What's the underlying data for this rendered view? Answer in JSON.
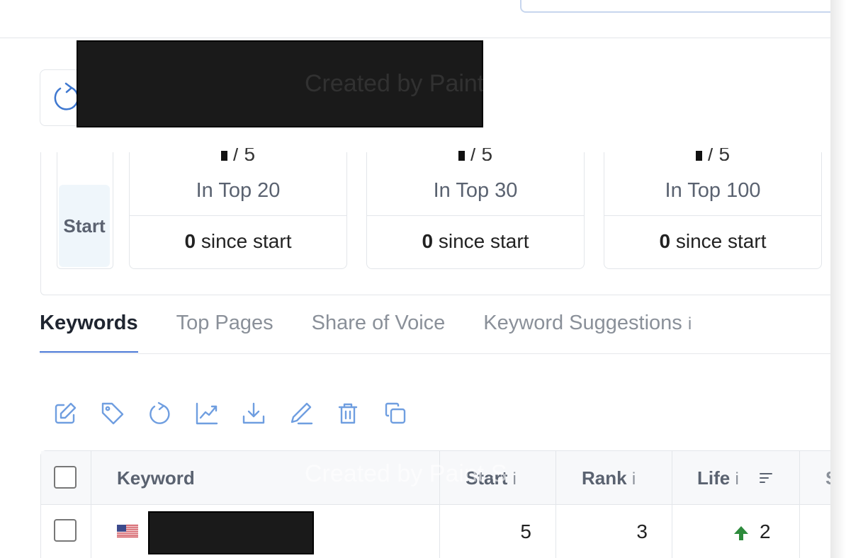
{
  "stats": {
    "start_label": "Start",
    "cards": [
      {
        "fraction_suffix": "/ 5",
        "label": "In Top 20",
        "since_value": "0",
        "since_text": "since start"
      },
      {
        "fraction_suffix": "/ 5",
        "label": "In Top 30",
        "since_value": "0",
        "since_text": "since start"
      },
      {
        "fraction_suffix": "/ 5",
        "label": "In Top 100",
        "since_value": "0",
        "since_text": "since start"
      }
    ]
  },
  "tabs": [
    {
      "label": "Keywords",
      "active": true
    },
    {
      "label": "Top Pages",
      "active": false
    },
    {
      "label": "Share of Voice",
      "active": false
    },
    {
      "label": "Keyword Suggestions",
      "info": "i",
      "active": false
    }
  ],
  "toolbar": {
    "icons": [
      "edit-icon",
      "tag-icon",
      "refresh-icon",
      "chart-icon",
      "download-icon",
      "pen-icon",
      "trash-icon",
      "copy-icon"
    ],
    "color": "#6f9ee0"
  },
  "table": {
    "headers": {
      "keyword": "Keyword",
      "start": "Start",
      "rank": "Rank",
      "life": "Life",
      "info": "i",
      "next_partial": "S"
    },
    "rows": [
      {
        "start": "5",
        "rank": "3",
        "life": "2",
        "life_trend": "up"
      }
    ]
  },
  "watermark": "Created by Paint S",
  "colors": {
    "accent": "#4a78d6",
    "up": "#2e8b3c",
    "icon": "#6f9ee0"
  }
}
